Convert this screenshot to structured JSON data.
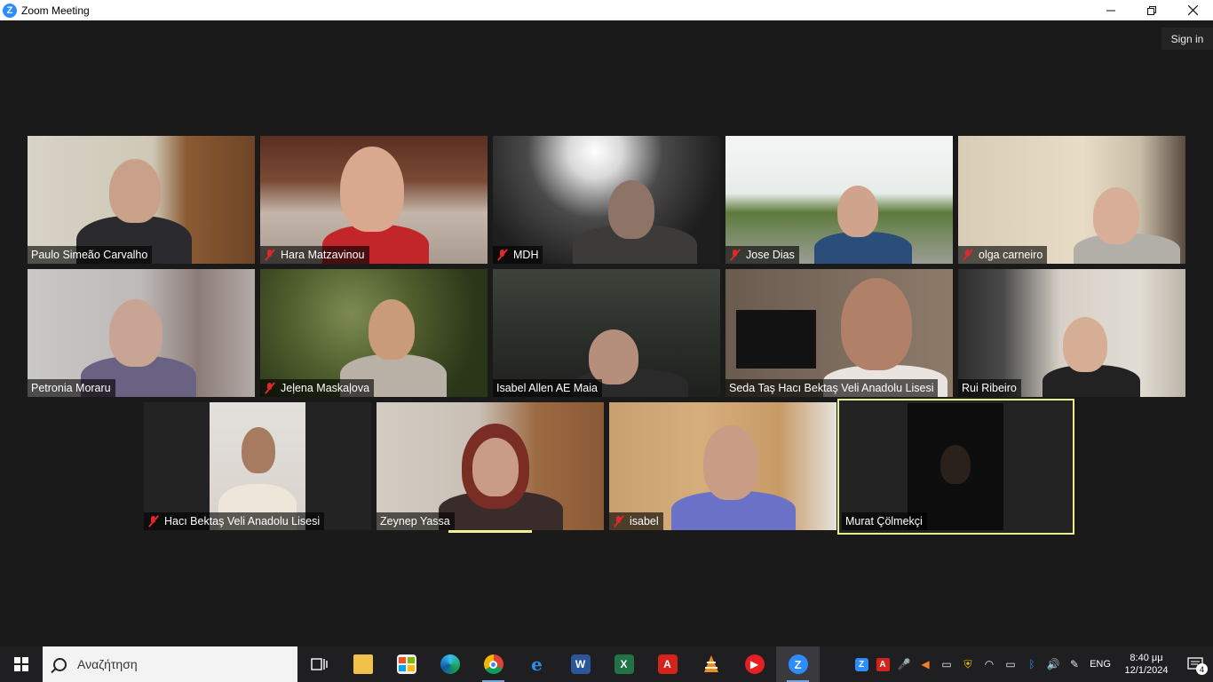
{
  "window": {
    "title": "Zoom Meeting"
  },
  "header": {
    "signin_label": "Sign in"
  },
  "participants": [
    {
      "name": "Paulo Simeão Carvalho",
      "muted": false
    },
    {
      "name": "Hara Matzavinou",
      "muted": true
    },
    {
      "name": "MDH",
      "muted": true
    },
    {
      "name": "Jose Dias",
      "muted": true
    },
    {
      "name": "olga carneiro",
      "muted": true
    },
    {
      "name": "Petronia Moraru",
      "muted": false
    },
    {
      "name": "Jeļena Maskaļova",
      "muted": true
    },
    {
      "name": "Isabel Allen AE Maia",
      "muted": false
    },
    {
      "name": "Seda Taş Hacı Bektaş Veli Anadolu Lisesi",
      "muted": false
    },
    {
      "name": "Rui Ribeiro",
      "muted": false
    },
    {
      "name": "Hacı Bektaş Veli Anadolu Lisesi",
      "muted": true
    },
    {
      "name": "Zeynep Yassa",
      "muted": false
    },
    {
      "name": "isabel",
      "muted": true
    },
    {
      "name": "Murat Çölmekçi",
      "muted": false
    }
  ],
  "taskbar": {
    "search_placeholder": "Αναζήτηση",
    "language": "ENG",
    "time": "8:40 μμ",
    "date": "12/1/2024",
    "notification_count": "4"
  },
  "colors": {
    "background": "#1a1a1a",
    "active_speaker": "#e9f08a",
    "muted_icon": "#e02828",
    "zoom_blue": "#2d8cff"
  }
}
